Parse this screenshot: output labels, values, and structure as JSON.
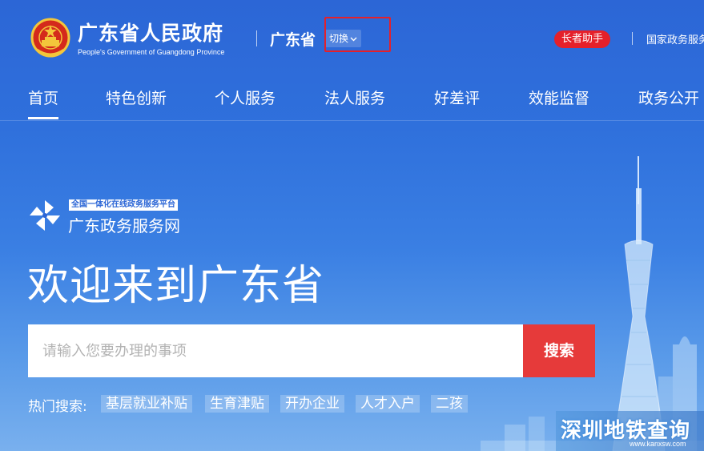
{
  "header": {
    "site_title": "广东省人民政府",
    "site_subtitle": "People's Government of Guangdong Province",
    "region_name": "广东省",
    "switch_label": "切换",
    "elder_assistant_label": "长者助手",
    "national_link_label": "国家政务服务"
  },
  "nav": {
    "items": [
      {
        "label": "首页",
        "active": true
      },
      {
        "label": "特色创新"
      },
      {
        "label": "个人服务"
      },
      {
        "label": "法人服务"
      },
      {
        "label": "好差评"
      },
      {
        "label": "效能监督"
      },
      {
        "label": "政务公开"
      }
    ]
  },
  "brand": {
    "tagline": "全国一体化在线政务服务平台",
    "name": "广东政务服务网"
  },
  "hero": {
    "welcome": "欢迎来到广东省"
  },
  "search": {
    "placeholder": "请输入您要办理的事项",
    "button_label": "搜索"
  },
  "hot_search": {
    "label": "热门搜索:",
    "tags": [
      "基层就业补贴",
      "生育津贴",
      "开办企业",
      "人才入户",
      "二孩"
    ]
  },
  "watermark": {
    "text": "深圳地铁查询",
    "url": "www.kanxsw.com"
  },
  "colors": {
    "background": "#2c66d6",
    "accent_red": "#e5202a",
    "search_button": "#e63a3a",
    "highlight_box": "#e5202a"
  },
  "icons": {
    "emblem": "national-emblem-icon",
    "switch_chevron": "chevron-down-icon",
    "brand_logo": "pinwheel-logo-icon"
  }
}
